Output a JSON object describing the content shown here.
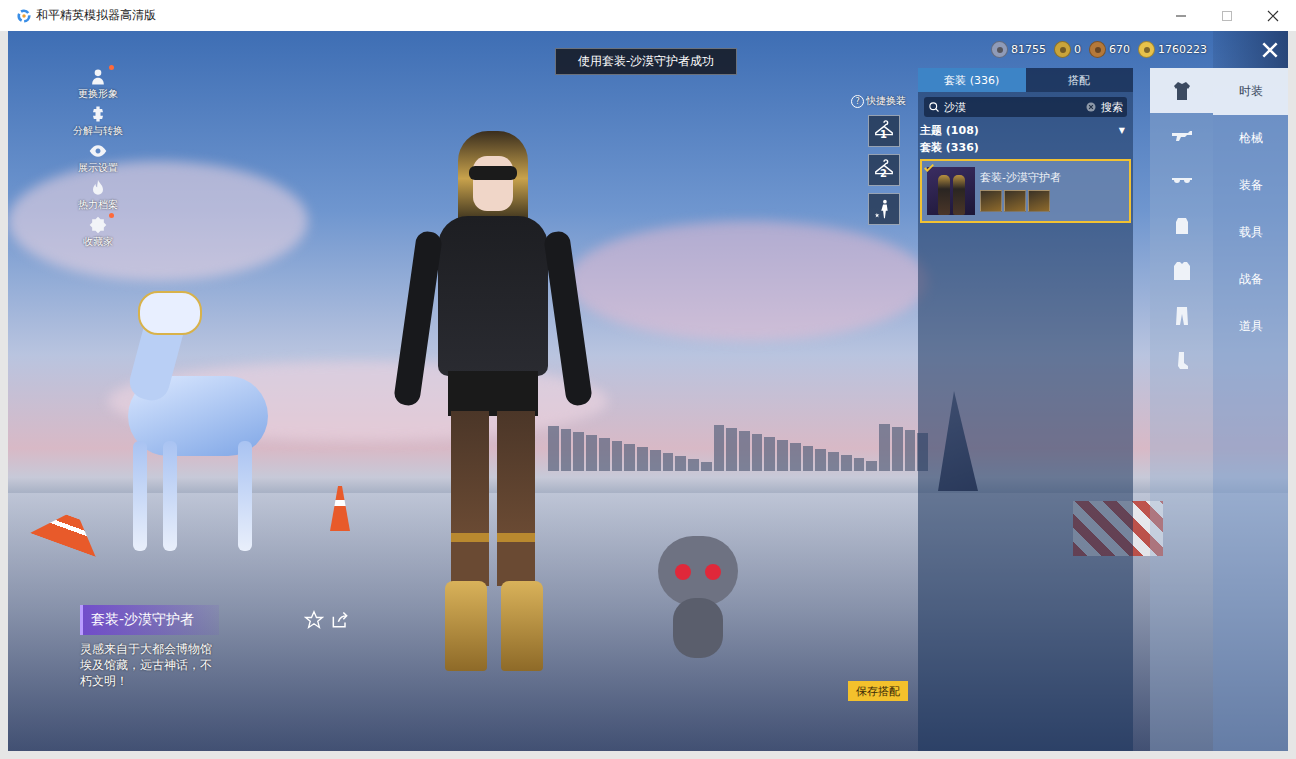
{
  "window": {
    "title": "和平精英模拟器高清版"
  },
  "toast": "使用套装-沙漠守护者成功",
  "currencies": [
    {
      "amount": "81755",
      "color": "#8f9bb8"
    },
    {
      "amount": "0",
      "color": "#c9a43a"
    },
    {
      "amount": "670",
      "color": "#b5793a"
    },
    {
      "amount": "1760223",
      "color": "#e8c24a"
    }
  ],
  "side_menu": [
    {
      "label": "更换形象",
      "badge": true
    },
    {
      "label": "分解与转换",
      "badge": false
    },
    {
      "label": "展示设置",
      "badge": false
    },
    {
      "label": "热力档案",
      "badge": false
    },
    {
      "label": "收藏家",
      "badge": true
    }
  ],
  "quick_change": {
    "label": "快捷换装",
    "help": "?",
    "slots": [
      "1",
      "2"
    ]
  },
  "panel": {
    "tabs": [
      {
        "label": "套装 (336)",
        "selected": true
      },
      {
        "label": "搭配",
        "selected": false
      }
    ],
    "search": {
      "value": "沙漠",
      "button": "搜索"
    },
    "theme_filter": {
      "label": "主题 (108)",
      "arrow": "▼"
    },
    "section_label": "套装 (336)",
    "items": [
      {
        "name": "套装-沙漠守护者",
        "selected": true
      }
    ]
  },
  "categories": [
    {
      "selected": true
    },
    {
      "selected": false
    },
    {
      "selected": false
    },
    {
      "selected": false
    },
    {
      "selected": false
    },
    {
      "selected": false
    },
    {
      "selected": false
    }
  ],
  "main_tabs": [
    {
      "label": "时装",
      "selected": true
    },
    {
      "label": "枪械",
      "selected": false
    },
    {
      "label": "装备",
      "selected": false
    },
    {
      "label": "载具",
      "selected": false
    },
    {
      "label": "战备",
      "selected": false
    },
    {
      "label": "道具",
      "selected": false
    }
  ],
  "outfit": {
    "name": "套装-沙漠守护者",
    "description": "灵感来自于大都会博物馆埃及馆藏，远古神话，不朽文明！"
  },
  "save_button": "保存搭配"
}
